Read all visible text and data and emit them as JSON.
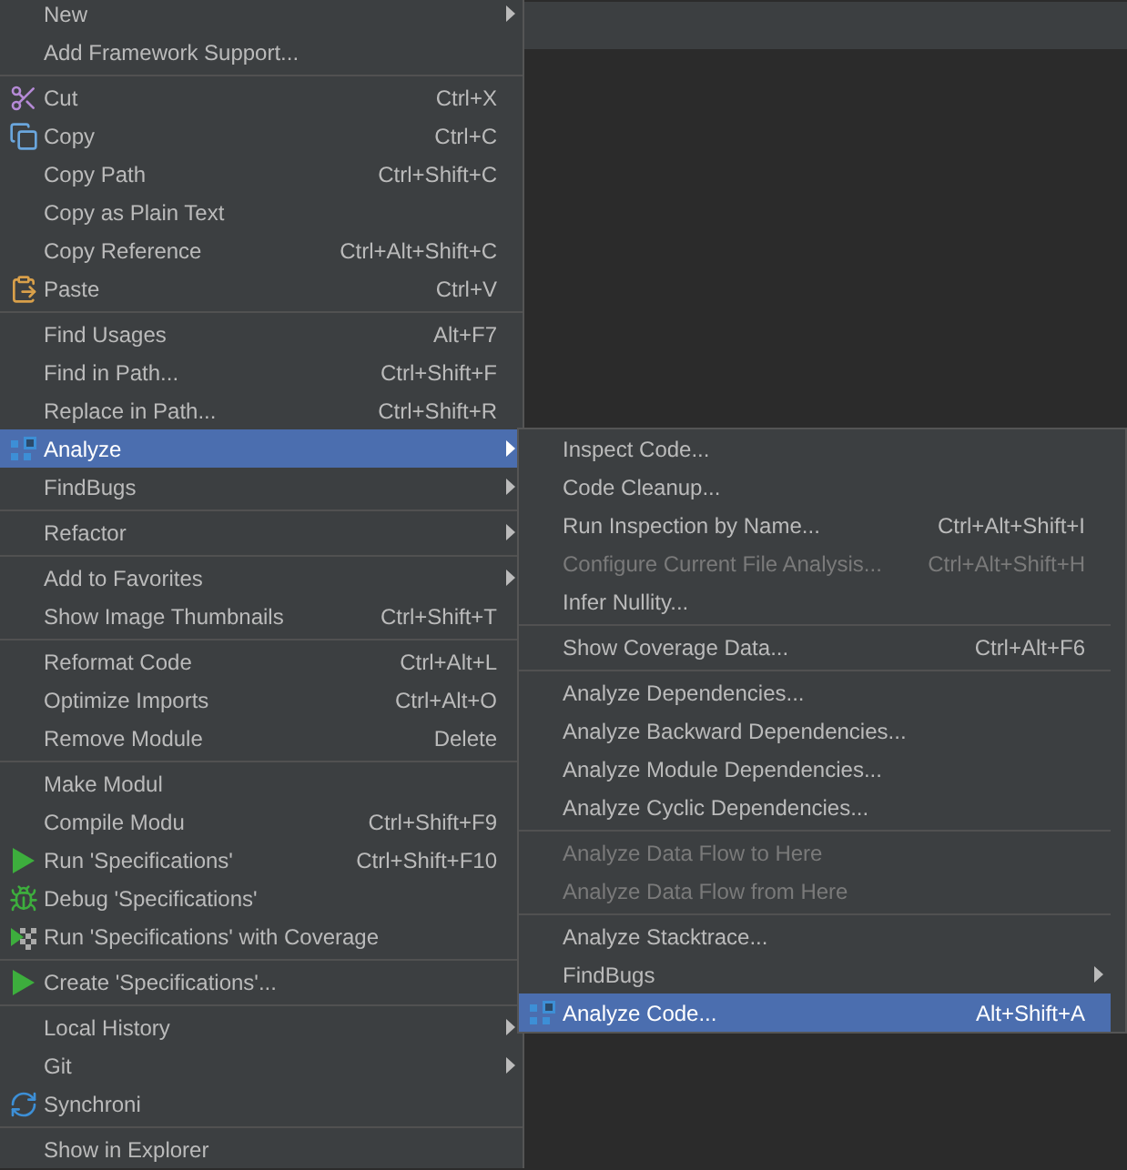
{
  "main_menu": {
    "items": [
      {
        "kind": "item",
        "label": "New",
        "has_submenu": true,
        "selected": false
      },
      {
        "kind": "item",
        "label": "Add Framework Support...",
        "has_submenu": false,
        "selected": false
      },
      {
        "kind": "separator"
      },
      {
        "kind": "item",
        "label": "Cut",
        "shortcut": "Ctrl+X",
        "has_submenu": false,
        "selected": false
      },
      {
        "kind": "item",
        "label": "Copy",
        "shortcut": "Ctrl+C",
        "has_submenu": false,
        "selected": false
      },
      {
        "kind": "item",
        "label": "Copy Path",
        "shortcut": "Ctrl+Shift+C",
        "has_submenu": false,
        "selected": false
      },
      {
        "kind": "item",
        "label": "Copy as Plain Text",
        "has_submenu": false,
        "selected": false
      },
      {
        "kind": "item",
        "label": "Copy Reference",
        "shortcut": "Ctrl+Alt+Shift+C",
        "has_submenu": false,
        "selected": false
      },
      {
        "kind": "item",
        "label": "Paste",
        "shortcut": "Ctrl+V",
        "has_submenu": false,
        "selected": false
      },
      {
        "kind": "separator"
      },
      {
        "kind": "item",
        "label": "Find Usages",
        "shortcut": "Alt+F7",
        "has_submenu": false,
        "selected": false
      },
      {
        "kind": "item",
        "label": "Find in Path...",
        "shortcut": "Ctrl+Shift+F",
        "has_submenu": false,
        "selected": false
      },
      {
        "kind": "item",
        "label": "Replace in Path...",
        "shortcut": "Ctrl+Shift+R",
        "has_submenu": false,
        "selected": false
      },
      {
        "kind": "item",
        "label": "Analyze",
        "has_submenu": true,
        "selected": true
      },
      {
        "kind": "item",
        "label": "FindBugs",
        "has_submenu": true,
        "selected": false
      },
      {
        "kind": "separator"
      },
      {
        "kind": "item",
        "label": "Refactor",
        "has_submenu": true,
        "selected": false
      },
      {
        "kind": "separator"
      },
      {
        "kind": "item",
        "label": "Add to Favorites",
        "has_submenu": true,
        "selected": false
      },
      {
        "kind": "item",
        "label": "Show Image Thumbnails",
        "shortcut": "Ctrl+Shift+T",
        "has_submenu": false,
        "selected": false
      },
      {
        "kind": "separator"
      },
      {
        "kind": "item",
        "label": "Reformat Code",
        "shortcut": "Ctrl+Alt+L",
        "has_submenu": false,
        "selected": false
      },
      {
        "kind": "item",
        "label": "Optimize Imports",
        "shortcut": "Ctrl+Alt+O",
        "has_submenu": false,
        "selected": false
      },
      {
        "kind": "item",
        "label": "Remove Module",
        "shortcut": "Delete",
        "has_submenu": false,
        "selected": false
      },
      {
        "kind": "separator"
      },
      {
        "kind": "item",
        "label": "Make Modul",
        "has_submenu": false,
        "selected": false
      },
      {
        "kind": "item",
        "label": "Compile Modu",
        "shortcut": "Ctrl+Shift+F9",
        "has_submenu": false,
        "selected": false
      },
      {
        "kind": "item",
        "label": "Run 'Specifications'",
        "shortcut": "Ctrl+Shift+F10",
        "has_submenu": false,
        "selected": false
      },
      {
        "kind": "item",
        "label": "Debug 'Specifications'",
        "has_submenu": false,
        "selected": false
      },
      {
        "kind": "item",
        "label": "Run 'Specifications' with Coverage",
        "has_submenu": false,
        "selected": false
      },
      {
        "kind": "separator"
      },
      {
        "kind": "item",
        "label": "Create 'Specifications'...",
        "has_submenu": false,
        "selected": false
      },
      {
        "kind": "separator"
      },
      {
        "kind": "item",
        "label": "Local History",
        "has_submenu": true,
        "selected": false
      },
      {
        "kind": "item",
        "label": "Git",
        "has_submenu": true,
        "selected": false
      },
      {
        "kind": "item",
        "label": "Synchroni",
        "has_submenu": false,
        "selected": false
      },
      {
        "kind": "separator"
      },
      {
        "kind": "item",
        "label": "Show in Explorer",
        "has_submenu": false,
        "selected": false
      }
    ]
  },
  "submenu": {
    "items": [
      {
        "kind": "item",
        "label": "Inspect Code...",
        "has_submenu": false,
        "selected": false,
        "disabled": false
      },
      {
        "kind": "item",
        "label": "Code Cleanup...",
        "has_submenu": false,
        "selected": false,
        "disabled": false
      },
      {
        "kind": "item",
        "label": "Run Inspection by Name...",
        "shortcut": "Ctrl+Alt+Shift+I",
        "has_submenu": false,
        "selected": false,
        "disabled": false
      },
      {
        "kind": "item",
        "label": "Configure Current File Analysis...",
        "shortcut": "Ctrl+Alt+Shift+H",
        "has_submenu": false,
        "selected": false,
        "disabled": true
      },
      {
        "kind": "item",
        "label": "Infer Nullity...",
        "has_submenu": false,
        "selected": false,
        "disabled": false
      },
      {
        "kind": "separator"
      },
      {
        "kind": "item",
        "label": "Show Coverage Data...",
        "shortcut": "Ctrl+Alt+F6",
        "has_submenu": false,
        "selected": false,
        "disabled": false
      },
      {
        "kind": "separator"
      },
      {
        "kind": "item",
        "label": "Analyze Dependencies...",
        "has_submenu": false,
        "selected": false,
        "disabled": false
      },
      {
        "kind": "item",
        "label": "Analyze Backward Dependencies...",
        "has_submenu": false,
        "selected": false,
        "disabled": false
      },
      {
        "kind": "item",
        "label": "Analyze Module Dependencies...",
        "has_submenu": false,
        "selected": false,
        "disabled": false
      },
      {
        "kind": "item",
        "label": "Analyze Cyclic Dependencies...",
        "has_submenu": false,
        "selected": false,
        "disabled": false
      },
      {
        "kind": "separator"
      },
      {
        "kind": "item",
        "label": "Analyze Data Flow to Here",
        "has_submenu": false,
        "selected": false,
        "disabled": true
      },
      {
        "kind": "item",
        "label": "Analyze Data Flow from Here",
        "has_submenu": false,
        "selected": false,
        "disabled": true
      },
      {
        "kind": "separator"
      },
      {
        "kind": "item",
        "label": "Analyze Stacktrace...",
        "has_submenu": false,
        "selected": false,
        "disabled": false
      },
      {
        "kind": "item",
        "label": "FindBugs",
        "has_submenu": true,
        "selected": false,
        "disabled": false
      },
      {
        "kind": "item",
        "label": "Analyze Code...",
        "shortcut": "Alt+Shift+A",
        "has_submenu": false,
        "selected": true,
        "disabled": false
      }
    ]
  }
}
